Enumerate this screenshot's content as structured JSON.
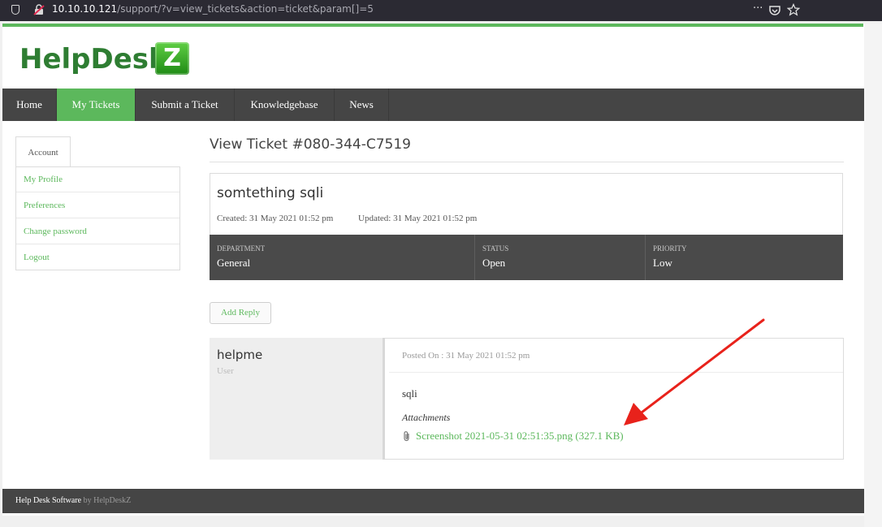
{
  "browser": {
    "url_host": "10.10.10.121",
    "url_path": "/support/?v=view_tickets&action=ticket&param[]=5",
    "menu_glyph": "···"
  },
  "header": {
    "logo_text": "HelpDesk",
    "logo_badge": "Z"
  },
  "nav": {
    "items": [
      {
        "label": "Home"
      },
      {
        "label": "My Tickets"
      },
      {
        "label": "Submit a Ticket"
      },
      {
        "label": "Knowledgebase"
      },
      {
        "label": "News"
      }
    ],
    "active_index": 1
  },
  "sidebar": {
    "tab_label": "Account",
    "items": [
      {
        "label": "My Profile"
      },
      {
        "label": "Preferences"
      },
      {
        "label": "Change password"
      },
      {
        "label": "Logout"
      }
    ]
  },
  "ticket": {
    "page_title": "View Ticket #080-344-C7519",
    "subject": "somtething sqli",
    "created": "Created: 31 May 2021 01:52 pm",
    "updated": "Updated: 31 May 2021 01:52 pm",
    "meta": [
      {
        "label": "DEPARTMENT",
        "value": "General"
      },
      {
        "label": "STATUS",
        "value": "Open"
      },
      {
        "label": "PRIORITY",
        "value": "Low"
      }
    ],
    "add_reply_label": "Add Reply"
  },
  "post": {
    "author": "helpme",
    "role": "User",
    "posted_on": "Posted On : 31 May 2021 01:52 pm",
    "message": "sqli",
    "attachments_label": "Attachments",
    "attachment_link": "Screenshot 2021-05-31 02:51:35.png (327.1 KB)"
  },
  "footer": {
    "text": "Help Desk Software",
    "by": "by HelpDeskZ"
  },
  "colors": {
    "accent": "#5cb85c",
    "nav_bg": "#454545",
    "annotation_arrow": "#e8221b"
  }
}
